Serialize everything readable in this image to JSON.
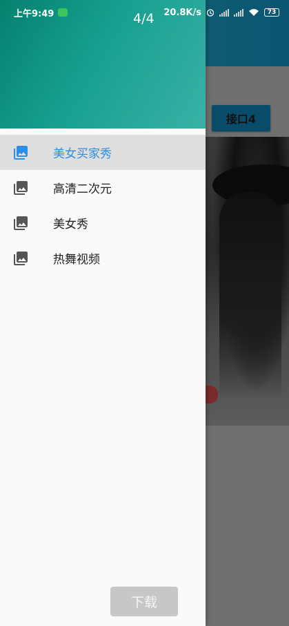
{
  "status_bar": {
    "time": "上午9:49",
    "network_speed": "20.8K/s",
    "battery": "73"
  },
  "pager": "4/4",
  "app": {
    "api_button_label": "接口4"
  },
  "drawer": {
    "items": [
      {
        "label": "美女买家秀",
        "icon": "photo-library-icon",
        "active": true
      },
      {
        "label": "高清二次元",
        "icon": "photo-library-icon",
        "active": false
      },
      {
        "label": "美女秀",
        "icon": "photo-library-icon",
        "active": false
      },
      {
        "label": "热舞视频",
        "icon": "photo-library-icon",
        "active": false
      }
    ]
  },
  "download_label": "下载",
  "colors": {
    "accent": "#2b8ee6",
    "icon_default": "#555555",
    "header_start": "#06806f",
    "header_end": "#3ab1a6"
  }
}
